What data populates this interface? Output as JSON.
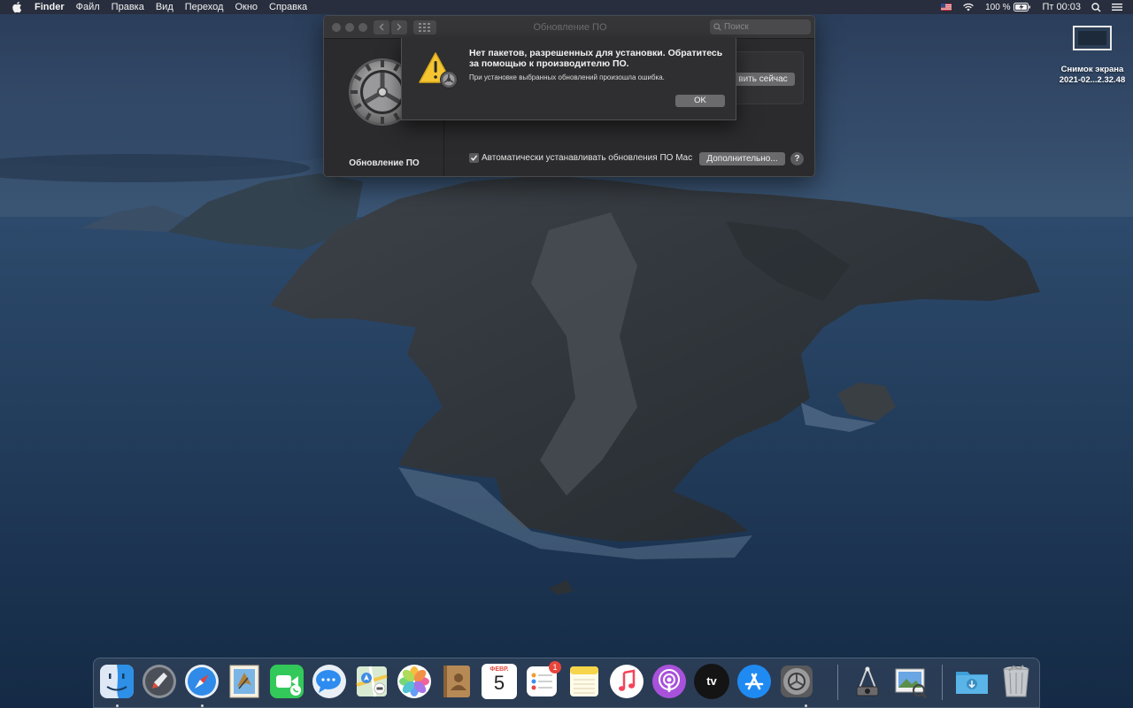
{
  "menubar": {
    "apple_icon": "apple-logo-icon",
    "app_name": "Finder",
    "items": [
      "Файл",
      "Правка",
      "Вид",
      "Переход",
      "Окно",
      "Справка"
    ],
    "battery_percent": "100 %",
    "clock": "Пт 00:03",
    "status_icons": [
      "us-flag-icon",
      "wifi-icon",
      "battery-charging-icon",
      "search-icon",
      "control-center-icon"
    ]
  },
  "desktop": {
    "file_name_line1": "Снимок экрана",
    "file_name_line2": "2021-02...2.32.48"
  },
  "prefs_window": {
    "title": "Обновление ПО",
    "search_placeholder": "Поиск",
    "sidebar_label": "Обновление ПО",
    "update_now_label": "вить сейчас",
    "auto_update_label": "Автоматически устанавливать обновления ПО Mac",
    "auto_update_checked": true,
    "advanced_label": "Дополнительно...",
    "help_label": "?"
  },
  "alert": {
    "title": "Нет пакетов, разрешенных для установки. Обратитесь за помощью к производителю ПО.",
    "message": "При установке выбранных обновлений произошла ошибка.",
    "ok_label": "OK"
  },
  "calendar": {
    "month": "ФЕВР.",
    "day": "5"
  },
  "reminders_badge": "1",
  "appletv_label": "tv",
  "dock": {
    "apps": [
      "finder",
      "launchpad",
      "safari",
      "mail",
      "facetime",
      "messages",
      "maps",
      "photos",
      "contacts",
      "calendar",
      "reminders",
      "notes",
      "music",
      "podcasts",
      "apple-tv",
      "app-store",
      "system-preferences"
    ],
    "running": [
      "finder",
      "safari",
      "system-preferences"
    ],
    "extras": [
      "screenshot-utility",
      "preview"
    ],
    "stacks": [
      "downloads",
      "trash"
    ]
  },
  "colors": {
    "menubar_bg": "#282c3a",
    "window_bg": "#2b2b2d",
    "alert_bg": "#2f2f31",
    "button_bg": "#6b6b6d",
    "warning_yellow": "#f4c531"
  }
}
